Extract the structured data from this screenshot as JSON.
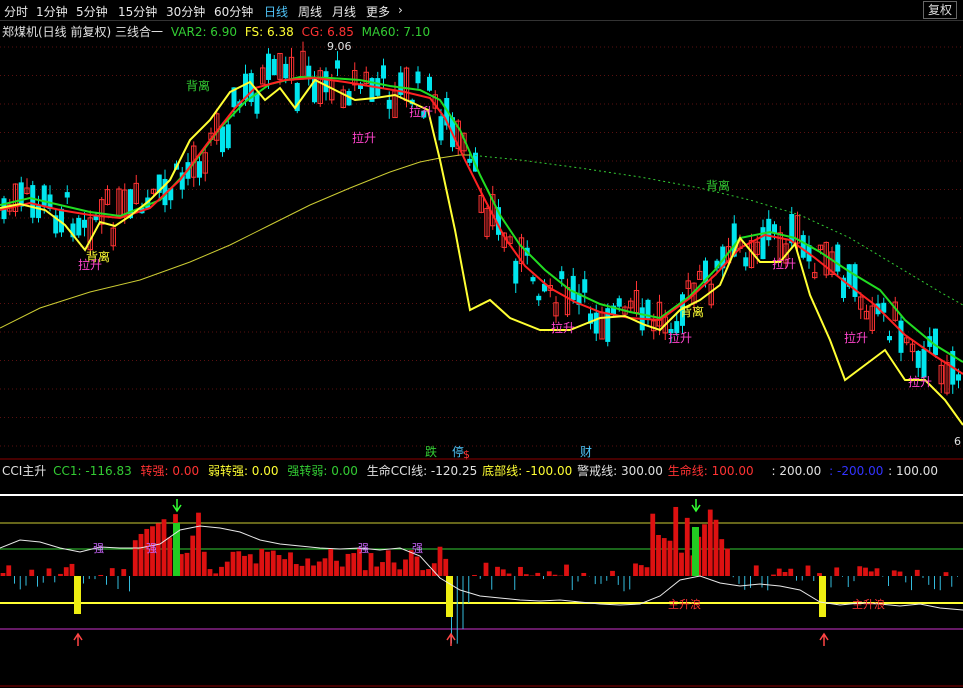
{
  "toolbar": {
    "tabs": [
      "分时",
      "1分钟",
      "5分钟",
      "15分钟",
      "30分钟",
      "60分钟",
      "日线",
      "周线",
      "月线",
      "更多"
    ],
    "active_tab": "日线",
    "restore_label": "复权"
  },
  "main_legend": {
    "title": "郑煤机(日线 前复权) 三线合一",
    "items": [
      {
        "label": "VAR2: 6.90",
        "color": "#33cc33"
      },
      {
        "label": "FS: 6.38",
        "color": "#ffff33"
      },
      {
        "label": "CG: 6.85",
        "color": "#ff3333"
      },
      {
        "label": "MA60: 7.10",
        "color": "#33cc33"
      }
    ]
  },
  "price_markers": {
    "high": "9.06",
    "low": "6"
  },
  "signals": {
    "divergence": "背离",
    "lift": "拉升",
    "strong": "强",
    "main_rise": "主升浪"
  },
  "event_markers": [
    {
      "text": "跌",
      "color": "#33cc33"
    },
    {
      "text": "停",
      "color": "#4fc3f7"
    },
    {
      "text": "$",
      "color": "#ff3333"
    },
    {
      "text": "财",
      "color": "#4fc3f7"
    }
  ],
  "sub_legend": {
    "items": [
      {
        "label": "CCI主升",
        "color": "#e0e0e0"
      },
      {
        "label": "CC1: -116.83",
        "color": "#33cc33"
      },
      {
        "label": "转强: 0.00",
        "color": "#ff3333"
      },
      {
        "label": "弱转强: 0.00",
        "color": "#ffff33"
      },
      {
        "label": "强转弱: 0.00",
        "color": "#33cc33"
      },
      {
        "label": "生命CCI线: -120.25",
        "color": "#e0e0e0"
      },
      {
        "label": "底部线: -100.00",
        "color": "#ffff33"
      },
      {
        "label": "警戒线: 300.00",
        "color": "#e0e0e0"
      },
      {
        "label": "生命线: 100.00",
        "color": "#ff3333"
      },
      {
        "label": ": 200.00",
        "color": "#e0e0e0"
      },
      {
        "label": ": -200.00",
        "color": "#3333ff"
      },
      {
        "label": ": 100.00",
        "color": "#e0e0e0"
      }
    ]
  },
  "colors": {
    "up": "#ff3333",
    "down": "#00e5ee",
    "ema_red": "#ff2222",
    "ema_green": "#22dd22",
    "fs": "#ffff33",
    "ma60": "#cccc33",
    "ma60_dash": "#33cc33"
  }
}
